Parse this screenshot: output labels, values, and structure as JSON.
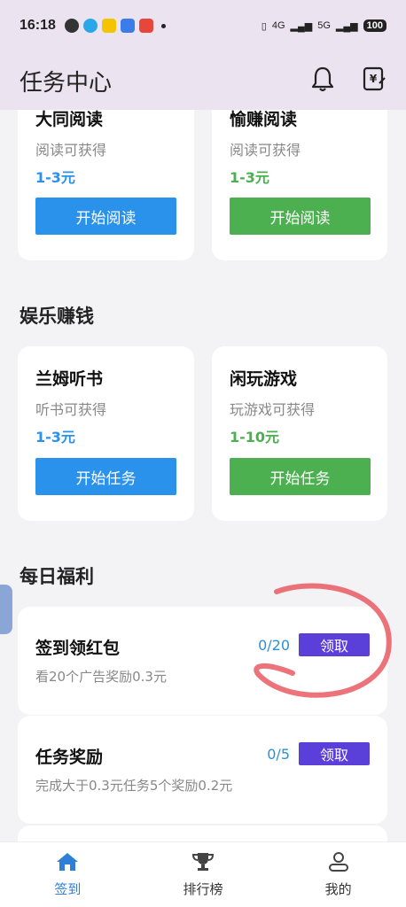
{
  "status_bar": {
    "time": "16:18",
    "network_1": "4G",
    "network_2": "5G",
    "battery": "100"
  },
  "app_bar": {
    "title": "任务中心"
  },
  "reading_cards": [
    {
      "title": "大同阅读",
      "subtitle": "阅读可获得",
      "reward": "1-3元",
      "button": "开始阅读",
      "color": "#2b92ec"
    },
    {
      "title": "愉赚阅读",
      "subtitle": "阅读可获得",
      "reward": "1-3元",
      "button": "开始阅读",
      "color": "#4caf50"
    }
  ],
  "entertainment": {
    "section_title": "娱乐赚钱",
    "cards": [
      {
        "title": "兰姆听书",
        "subtitle": "听书可获得",
        "reward": "1-3元",
        "button": "开始任务",
        "color": "#2b92ec"
      },
      {
        "title": "闲玩游戏",
        "subtitle": "玩游戏可获得",
        "reward": "1-10元",
        "button": "开始任务",
        "color": "#4caf50"
      }
    ]
  },
  "welfare": {
    "section_title": "每日福利",
    "items": [
      {
        "title": "签到领红包",
        "desc": "看20个广告奖励0.3元",
        "progress": "0/20",
        "button": "领取"
      },
      {
        "title": "任务奖励",
        "desc": "完成大于0.3元任务5个奖励0.2元",
        "progress": "0/5",
        "button": "领取"
      }
    ]
  },
  "bottom_nav": [
    {
      "label": "签到",
      "icon": "home-icon",
      "active": true
    },
    {
      "label": "排行榜",
      "icon": "trophy-icon",
      "active": false
    },
    {
      "label": "我的",
      "icon": "user-icon",
      "active": false
    }
  ],
  "colors": {
    "blue": "#2b92ec",
    "green": "#4caf50",
    "purple_button": "#5a3fd8",
    "progress_blue": "#2f8fd6",
    "nav_active": "#2f7fd6"
  }
}
